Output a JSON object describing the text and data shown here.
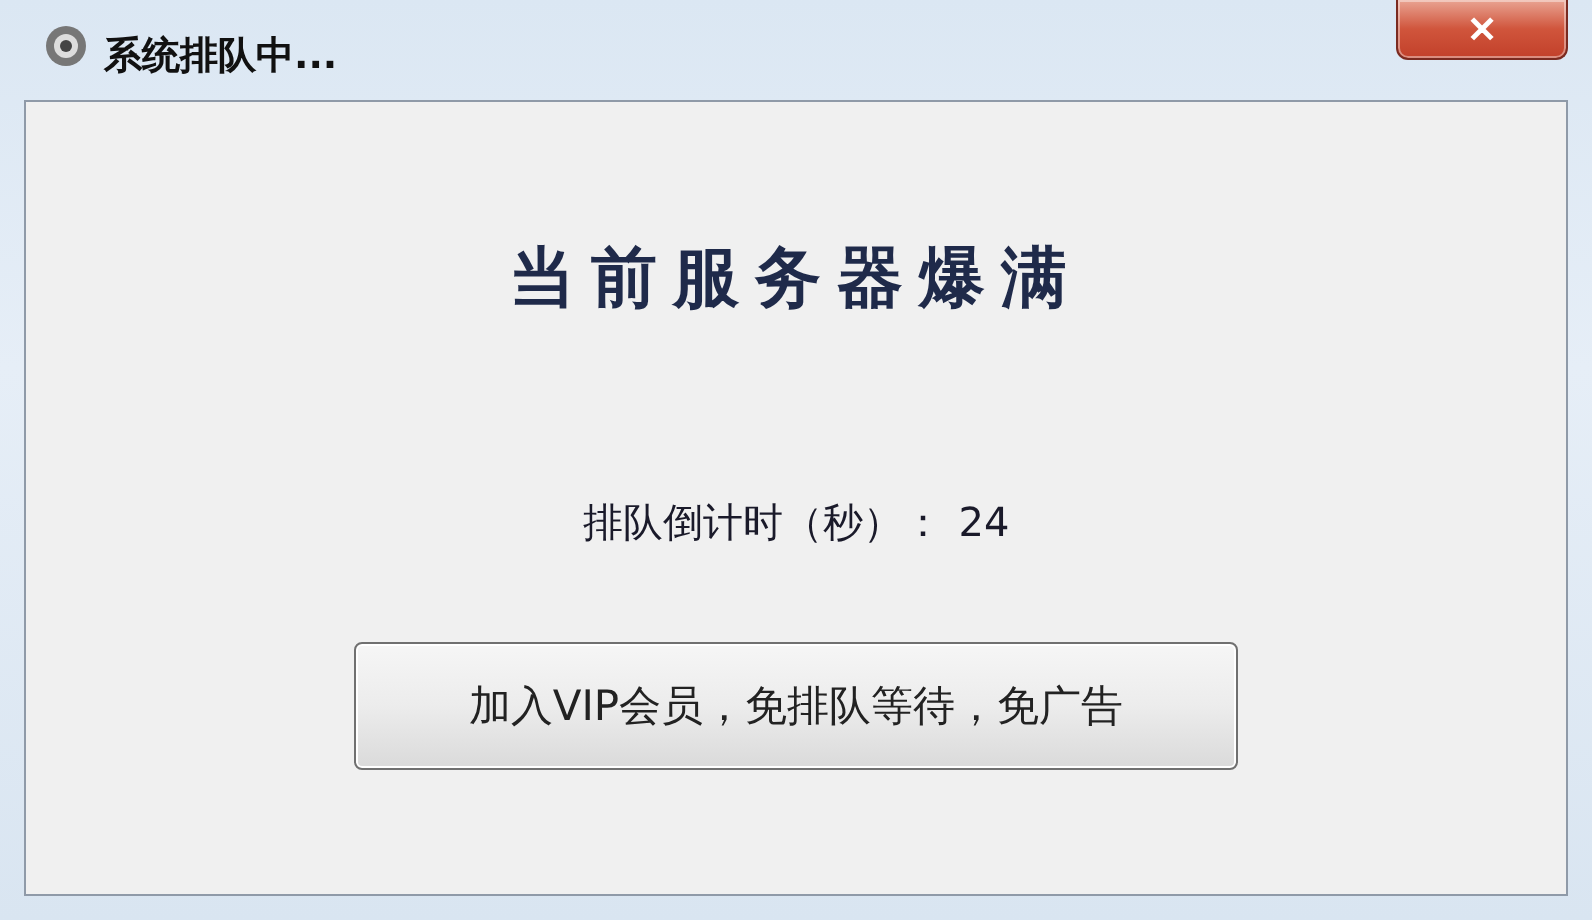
{
  "window": {
    "title": "系统排队中...",
    "close": "✕"
  },
  "headline": "当前服务器爆满",
  "countdown": {
    "label": "排队倒计时（秒）：",
    "value": "24"
  },
  "buttons": [
    "加入VIP会员，免排队等待，免广告"
  ]
}
